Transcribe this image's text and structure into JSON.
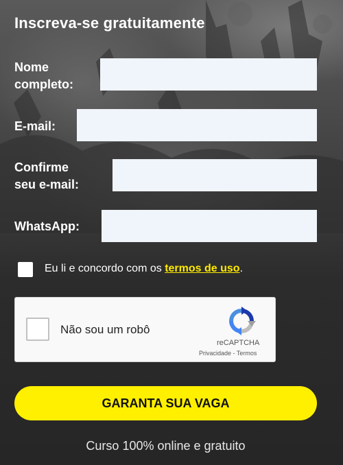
{
  "form": {
    "title": "Inscreva-se gratuitamente",
    "fields": [
      {
        "label_line1": "Nome",
        "label_line2": "completo:",
        "value": ""
      },
      {
        "label_line1": "E-mail:",
        "label_line2": "",
        "value": ""
      },
      {
        "label_line1": "Confirme",
        "label_line2": "seu e-mail:",
        "value": ""
      },
      {
        "label_line1": "WhatsApp:",
        "label_line2": "",
        "value": ""
      }
    ],
    "terms": {
      "checked": false,
      "text_before": "Eu li e concordo com os ",
      "link_text": "termos de uso",
      "text_after": "."
    },
    "recaptcha": {
      "label": "Não sou um robô",
      "brand": "reCAPTCHA",
      "privacy": "Privacidade",
      "separator": " - ",
      "terms": "Termos"
    },
    "submit_label": "GARANTA SUA VAGA",
    "footnote": "Curso 100% online e gratuito"
  },
  "colors": {
    "accent_yellow": "#fff000",
    "link_yellow": "#ffec00",
    "input_bg": "#f0f4fb"
  },
  "icons": {
    "recaptcha": "recaptcha-logo-icon"
  }
}
